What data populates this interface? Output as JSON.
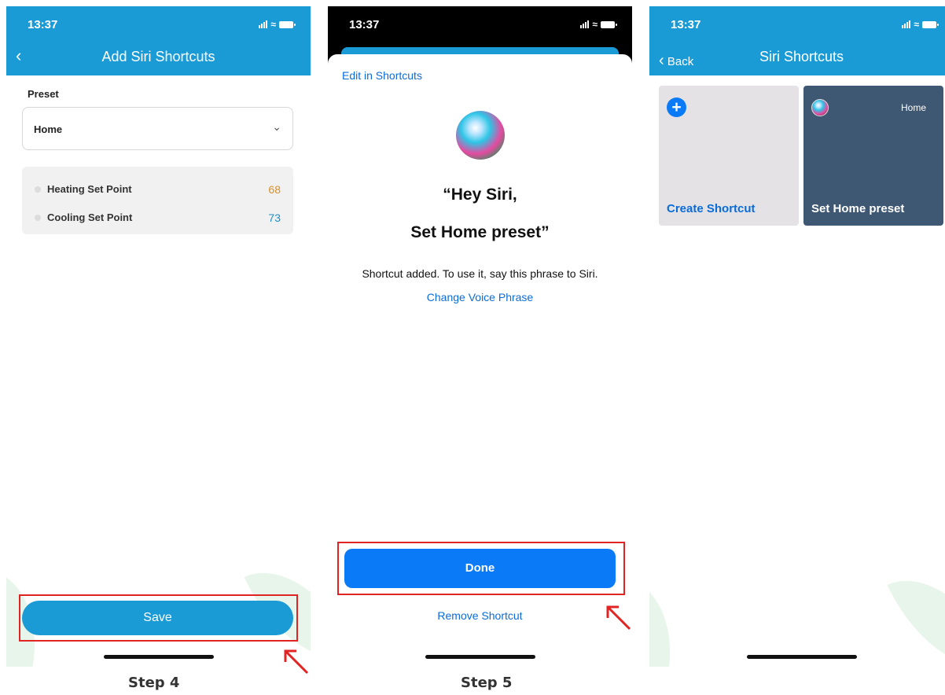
{
  "phone1": {
    "status_time": "13:37",
    "nav_title": "Add Siri Shortcuts",
    "preset_label": "Preset",
    "preset_value": "Home",
    "setpoints": [
      {
        "name": "Heating Set Point",
        "value": "68"
      },
      {
        "name": "Cooling Set Point",
        "value": "73"
      }
    ],
    "save_label": "Save"
  },
  "phone2": {
    "status_time": "13:37",
    "edit_link": "Edit in Shortcuts",
    "phrase_line1": "“Hey Siri,",
    "phrase_line2": "Set Home preset”",
    "added_message": "Shortcut added. To use it, say this phrase to Siri.",
    "change_phrase": "Change Voice Phrase",
    "done_label": "Done",
    "remove_label": "Remove Shortcut"
  },
  "phone3": {
    "status_time": "13:37",
    "back_label": "Back",
    "nav_title": "Siri Shortcuts",
    "create_label": "Create Shortcut",
    "home_tag": "Home",
    "shortcut_label": "Set Home preset"
  },
  "steps": {
    "step4": "Step 4",
    "step5": "Step 5"
  },
  "colors": {
    "app_blue": "#1b9bd6",
    "ios_blue": "#0a7af7",
    "highlight_red": "#e02424",
    "heating": "#d8902b",
    "cooling": "#1f8fc5",
    "shortcut_card": "#3e5873"
  }
}
